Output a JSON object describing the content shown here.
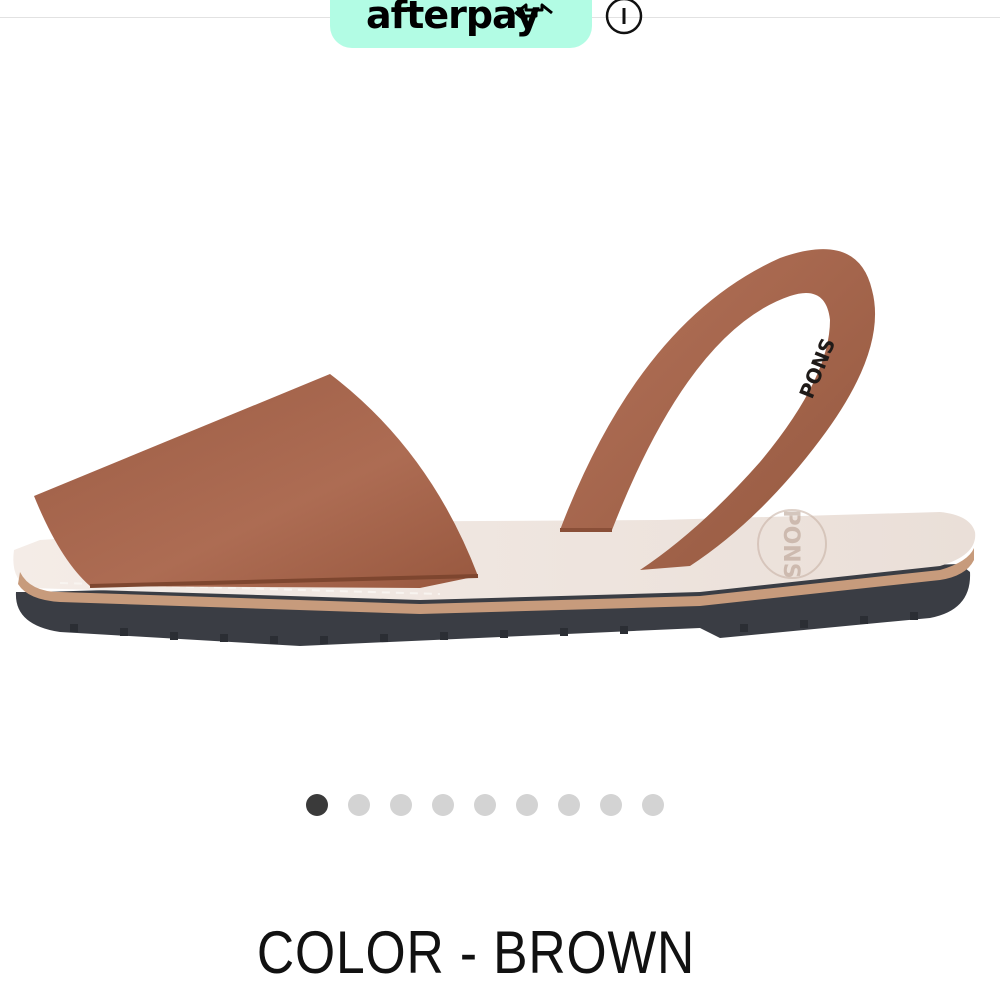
{
  "header": {
    "afterpay_badge": {
      "label": "afterpay",
      "logo_icon": "afterpay-arrows-icon",
      "background_color": "#b2fce4"
    },
    "info_icon": "info-circle-icon"
  },
  "product_gallery": {
    "image": {
      "subject": "brown leather avarca sandal",
      "brand_mark": "PONS"
    },
    "slide_count": 9,
    "active_slide": 1,
    "dot_color": "#d3d3d3",
    "active_dot_color": "#3a3a3a"
  },
  "product": {
    "color_label": "COLOR - BROWN"
  }
}
